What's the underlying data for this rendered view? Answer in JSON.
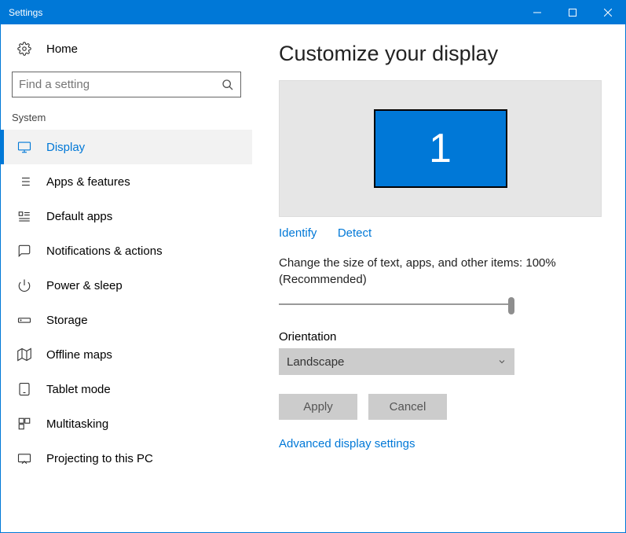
{
  "titlebar": {
    "title": "Settings"
  },
  "sidebar": {
    "home": "Home",
    "search_placeholder": "Find a setting",
    "section": "System",
    "items": [
      {
        "label": "Display",
        "active": true
      },
      {
        "label": "Apps & features"
      },
      {
        "label": "Default apps"
      },
      {
        "label": "Notifications & actions"
      },
      {
        "label": "Power & sleep"
      },
      {
        "label": "Storage"
      },
      {
        "label": "Offline maps"
      },
      {
        "label": "Tablet mode"
      },
      {
        "label": "Multitasking"
      },
      {
        "label": "Projecting to this PC"
      }
    ]
  },
  "main": {
    "heading": "Customize your display",
    "monitor_number": "1",
    "identify": "Identify",
    "detect": "Detect",
    "size_text": "Change the size of text, apps, and other items: 100% (Recommended)",
    "orientation_label": "Orientation",
    "orientation_value": "Landscape",
    "apply": "Apply",
    "cancel": "Cancel",
    "advanced": "Advanced display settings"
  }
}
